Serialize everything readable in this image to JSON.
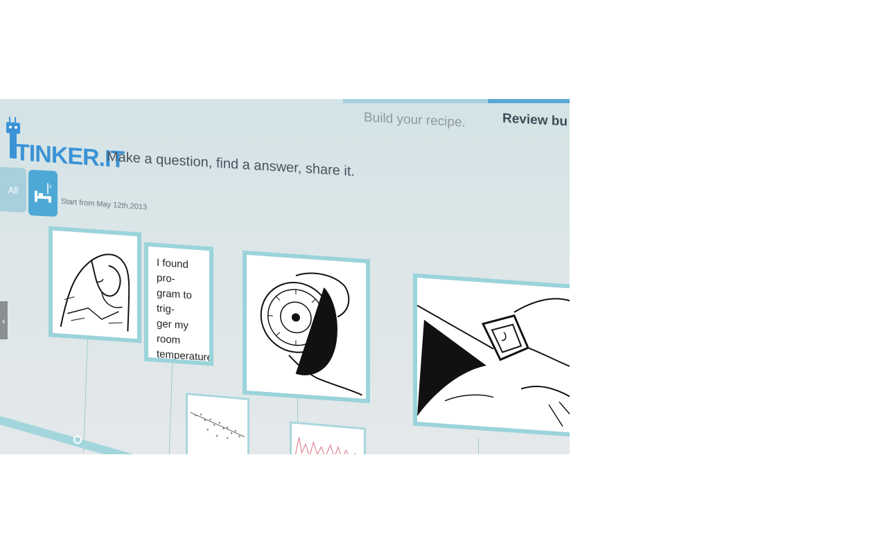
{
  "progress": {
    "fraction": 0.36
  },
  "steps": {
    "build": "Build your recipe.",
    "review": "Review bu"
  },
  "header": {
    "logo_text": "TINKER.IT",
    "tagline": "Make a question, find a answer, share it."
  },
  "filters": {
    "all_label": "All",
    "bed_icon": "bed-icon"
  },
  "timeline": {
    "start_date": "Start from May 12th,2013"
  },
  "nav": {
    "prev_icon": "chevron-left-icon"
  },
  "cards": [
    {
      "illustration": "person-wrapped-in-blanket"
    },
    {
      "text": "I found pro-\ngram to trig-\nger my room\ntemperature\ncontroller..."
    },
    {
      "illustration": "hand-turning-thermostat-dial"
    },
    {
      "illustration": "wrist-device-on-sleeping-arm"
    }
  ],
  "colors": {
    "accent": "#3b93d6",
    "card_border": "#9bd3da",
    "screen_bg": "#d3e3e6"
  }
}
